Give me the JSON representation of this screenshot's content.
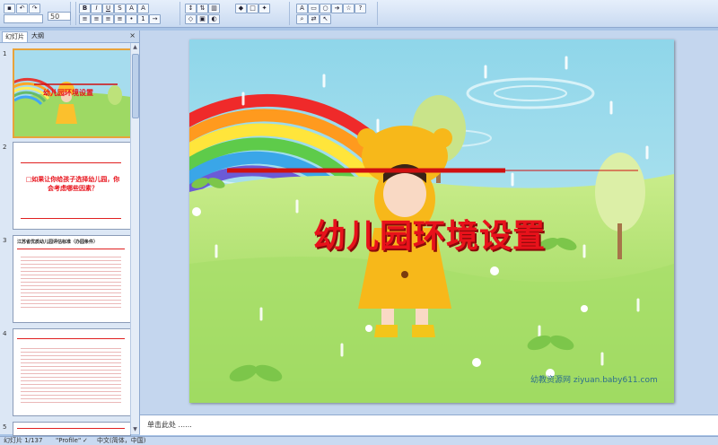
{
  "toolbar": {
    "font_size": "50",
    "buttons": [
      "B",
      "I",
      "U",
      "S",
      "A",
      "A"
    ]
  },
  "panel": {
    "tabs": [
      "幻灯片",
      "大纲"
    ],
    "close": "×",
    "slides": [
      {
        "num": "1",
        "title": "幼儿园环境设置"
      },
      {
        "num": "2",
        "title": "□如果让你给孩子选择幼儿园，你会考虑哪些因素？"
      },
      {
        "num": "3",
        "title": "江苏省优质幼儿园评估标准（办园条件）"
      },
      {
        "num": "4",
        "title": ""
      },
      {
        "num": "5",
        "title": ""
      }
    ]
  },
  "slide": {
    "title": "幼儿园环境设置",
    "watermark": "幼教资源网 ziyuan.baby611.com"
  },
  "notes": {
    "text": "单击此处  ......"
  },
  "status": {
    "slide_info": "幻灯片 1/137",
    "theme": "\"Profile\"",
    "language": "中文(简体，中国)"
  },
  "colors": {
    "title_red": "#e8121b",
    "ribbon": "#dbe7f7"
  }
}
